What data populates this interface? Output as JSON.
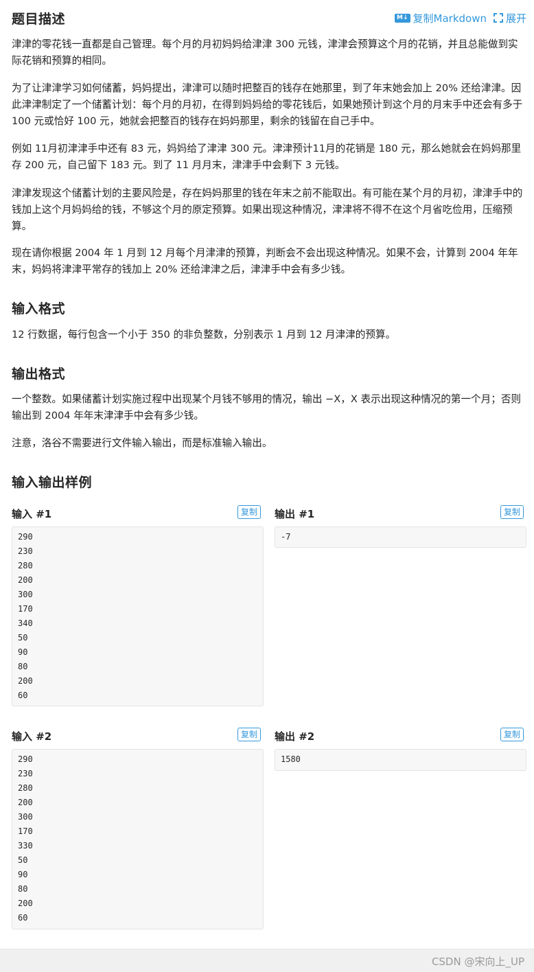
{
  "header": {
    "title": "题目描述",
    "copy_markdown": "复制Markdown",
    "md_badge": "M↓",
    "expand": "展开"
  },
  "description": {
    "p1": "津津的零花钱一直都是自己管理。每个月的月初妈妈给津津 300 元钱，津津会预算这个月的花销，并且总能做到实际花销和预算的相同。",
    "p2": "为了让津津学习如何储蓄，妈妈提出，津津可以随时把整百的钱存在她那里，到了年末她会加上 20% 还给津津。因此津津制定了一个储蓄计划：每个月的月初，在得到妈妈给的零花钱后，如果她预计到这个月的月末手中还会有多于 100 元或恰好 100 元，她就会把整百的钱存在妈妈那里，剩余的钱留在自己手中。",
    "p3": "例如 11月初津津手中还有 83 元，妈妈给了津津 300 元。津津预计11月的花销是 180 元，那么她就会在妈妈那里存 200 元，自己留下 183 元。到了 11 月月末，津津手中会剩下 3 元钱。",
    "p4": "津津发现这个储蓄计划的主要风险是，存在妈妈那里的钱在年末之前不能取出。有可能在某个月的月初，津津手中的钱加上这个月妈妈给的钱，不够这个月的原定预算。如果出现这种情况，津津将不得不在这个月省吃俭用，压缩预算。",
    "p5": "现在请你根据 2004 年 1 月到 12 月每个月津津的预算，判断会不会出现这种情况。如果不会，计算到 2004 年年末，妈妈将津津平常存的钱加上 20% 还给津津之后，津津手中会有多少钱。"
  },
  "input_format": {
    "title": "输入格式",
    "text": "12 行数据，每行包含一个小于 350 的非负整数，分别表示 1 月到 12 月津津的预算。"
  },
  "output_format": {
    "title": "输出格式",
    "text": "一个整数。如果储蓄计划实施过程中出现某个月钱不够用的情况，输出 −X，X 表示出现这种情况的第一个月；否则输出到 2004 年年末津津手中会有多少钱。",
    "note": "注意，洛谷不需要进行文件输入输出，而是标准输入输出。"
  },
  "samples": {
    "title": "输入输出样例",
    "copy_label": "复制",
    "input1_label": "输入 #1",
    "output1_label": "输出 #1",
    "input2_label": "输入 #2",
    "output2_label": "输出 #2",
    "input1": [
      "290",
      "230",
      "280",
      "200",
      "300",
      "170",
      "340",
      "50",
      "90",
      "80",
      "200",
      "60"
    ],
    "output1": [
      "-7"
    ],
    "input2": [
      "290",
      "230",
      "280",
      "200",
      "300",
      "170",
      "330",
      "50",
      "90",
      "80",
      "200",
      "60"
    ],
    "output2": [
      "1580"
    ]
  },
  "footer": {
    "watermark": "CSDN @宋向上_UP"
  }
}
